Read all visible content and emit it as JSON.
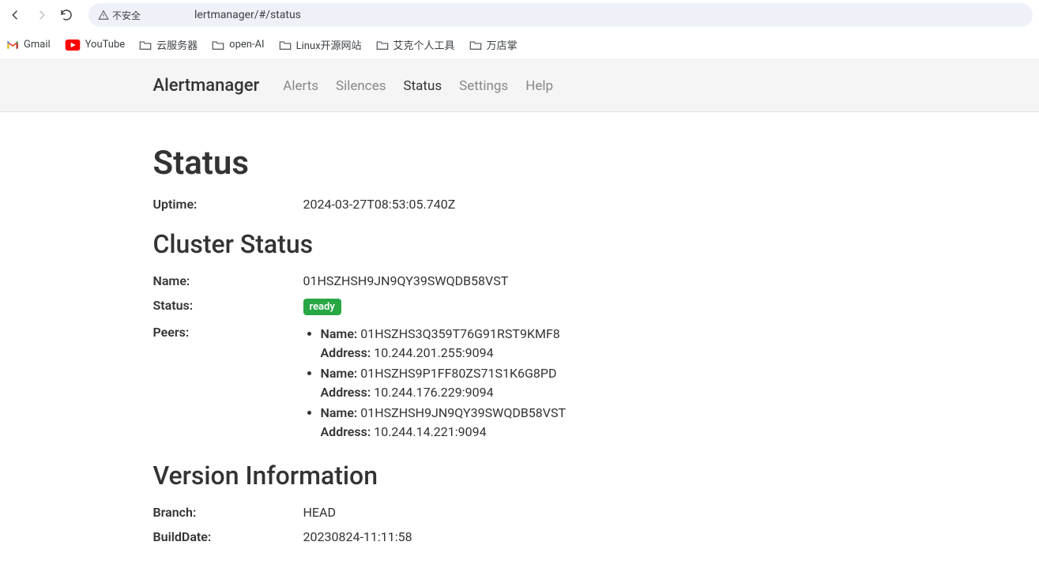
{
  "browser": {
    "insecure_label": "不安全",
    "url_display": "lertmanager/#/status"
  },
  "bookmarks": [
    {
      "label": "Gmail",
      "icon": "gmail"
    },
    {
      "label": "YouTube",
      "icon": "youtube"
    },
    {
      "label": "云服务器",
      "icon": "folder"
    },
    {
      "label": "open-AI",
      "icon": "folder"
    },
    {
      "label": "Linux开源网站",
      "icon": "folder"
    },
    {
      "label": "艾克个人工具",
      "icon": "folder"
    },
    {
      "label": "万店掌",
      "icon": "folder"
    }
  ],
  "nav": {
    "brand": "Alertmanager",
    "items": [
      "Alerts",
      "Silences",
      "Status",
      "Settings",
      "Help"
    ],
    "active_index": 2
  },
  "status": {
    "title": "Status",
    "uptime_label": "Uptime:",
    "uptime_value": "2024-03-27T08:53:05.740Z",
    "cluster_title": "Cluster Status",
    "name_label": "Name:",
    "name_value": "01HSZHSH9JN9QY39SWQDB58VST",
    "status_label": "Status:",
    "status_value": "ready",
    "peers_label": "Peers:",
    "peer_name_label": "Name:",
    "peer_addr_label": "Address:",
    "peers": [
      {
        "name": "01HSZHS3Q359T76G91RST9KMF8",
        "address": "10.244.201.255:9094"
      },
      {
        "name": "01HSZHS9P1FF80ZS71S1K6G8PD",
        "address": "10.244.176.229:9094"
      },
      {
        "name": "01HSZHSH9JN9QY39SWQDB58VST",
        "address": "10.244.14.221:9094"
      }
    ],
    "version_title": "Version Information",
    "branch_label": "Branch:",
    "branch_value": "HEAD",
    "builddate_label": "BuildDate:",
    "builddate_value": "20230824-11:11:58"
  }
}
